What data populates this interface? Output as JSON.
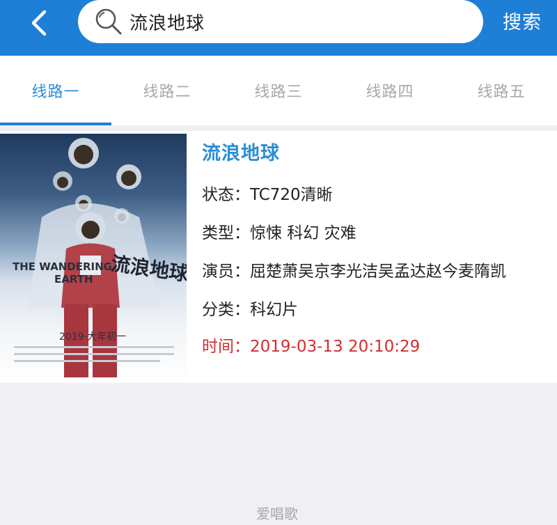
{
  "header": {
    "back_icon": "chevron-left-icon",
    "search_icon": "search-icon",
    "search_value": "流浪地球",
    "search_button_label": "搜索",
    "bar_color": "#1d7fd6"
  },
  "tabs": [
    {
      "label": "线路一",
      "active": true
    },
    {
      "label": "线路二",
      "active": false
    },
    {
      "label": "线路三",
      "active": false
    },
    {
      "label": "线路四",
      "active": false
    },
    {
      "label": "线路五",
      "active": false
    }
  ],
  "movie": {
    "title": "流浪地球",
    "poster": {
      "en_title_line1": "THE WANDERING",
      "en_title_line2": "EARTH",
      "cn_title": "流浪地球",
      "date": "2019·大年初一"
    },
    "fields": [
      {
        "label": "状态：",
        "value": "TC720清晰"
      },
      {
        "label": "类型：",
        "value": "惊悚 科幻 灾难"
      },
      {
        "label": "演员：",
        "value": "屈楚萧吴京李光洁吴孟达赵今麦隋凯"
      },
      {
        "label": "分类：",
        "value": "科幻片"
      },
      {
        "label": "时间：",
        "value": "2019-03-13 20:10:29"
      }
    ]
  },
  "watermark": "爱唱歌"
}
